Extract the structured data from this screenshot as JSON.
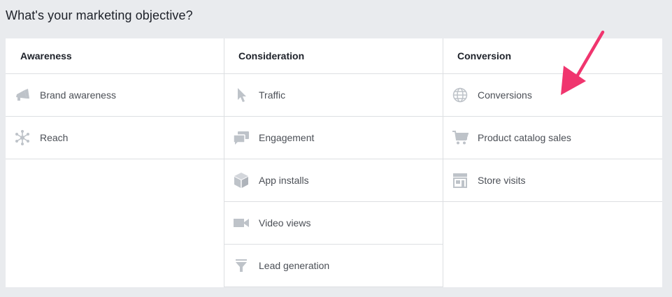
{
  "page": {
    "title": "What's your marketing objective?"
  },
  "columns": [
    {
      "header": "Awareness",
      "items": [
        {
          "label": "Brand awareness",
          "icon": "megaphone-icon"
        },
        {
          "label": "Reach",
          "icon": "reach-icon"
        }
      ]
    },
    {
      "header": "Consideration",
      "items": [
        {
          "label": "Traffic",
          "icon": "cursor-icon"
        },
        {
          "label": "Engagement",
          "icon": "chat-bubbles-icon"
        },
        {
          "label": "App installs",
          "icon": "box-icon"
        },
        {
          "label": "Video views",
          "icon": "video-camera-icon"
        },
        {
          "label": "Lead generation",
          "icon": "funnel-icon"
        }
      ]
    },
    {
      "header": "Conversion",
      "items": [
        {
          "label": "Conversions",
          "icon": "globe-icon"
        },
        {
          "label": "Product catalog sales",
          "icon": "cart-icon"
        },
        {
          "label": "Store visits",
          "icon": "store-icon"
        }
      ]
    }
  ],
  "colors": {
    "icon": "#bec3c9",
    "arrow": "#f0356e"
  }
}
